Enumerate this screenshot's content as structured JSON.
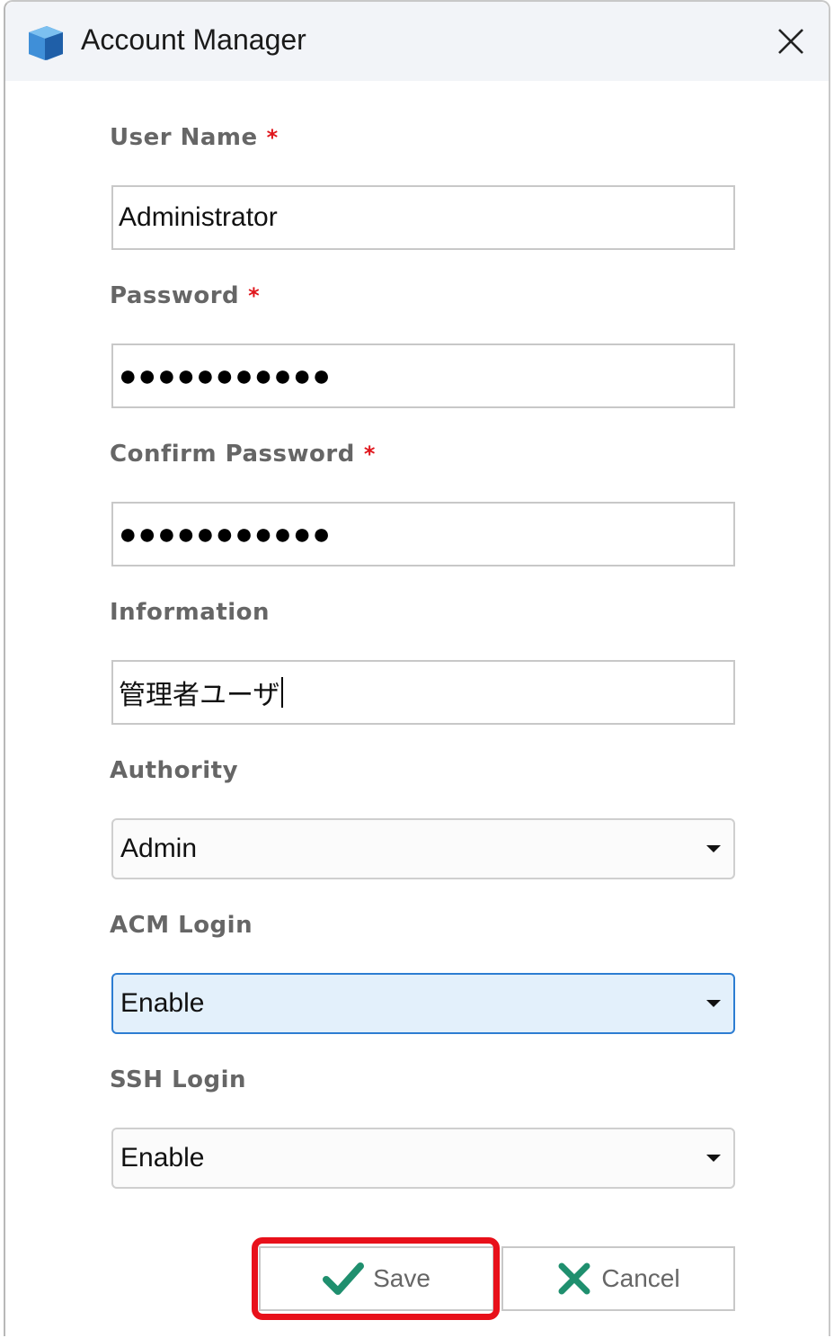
{
  "window": {
    "title": "Account Manager",
    "icons": {
      "app": "blue-cube-icon",
      "close": "close-icon"
    }
  },
  "form": {
    "required_mark": "*",
    "username": {
      "label": "User Name",
      "value": "Administrator",
      "required": true
    },
    "password": {
      "label": "Password",
      "value": "●●●●●●●●●●●",
      "required": true
    },
    "confirm_password": {
      "label": "Confirm Password",
      "value": "●●●●●●●●●●●",
      "required": true
    },
    "information": {
      "label": "Information",
      "value": "管理者ユーザ"
    },
    "authority": {
      "label": "Authority",
      "value": "Admin"
    },
    "acm_login": {
      "label": "ACM Login",
      "value": "Enable"
    },
    "ssh_login": {
      "label": "SSH Login",
      "value": "Enable"
    }
  },
  "buttons": {
    "save": {
      "label": "Save",
      "icon": "checkmark-icon",
      "highlighted": true
    },
    "cancel": {
      "label": "Cancel",
      "icon": "x-icon"
    }
  },
  "colors": {
    "required": "#e0161c",
    "highlight": "#e8101a",
    "check": "#1f8f6e",
    "focus_bg": "#e3f0fb",
    "focus_border": "#2d7dd2"
  }
}
